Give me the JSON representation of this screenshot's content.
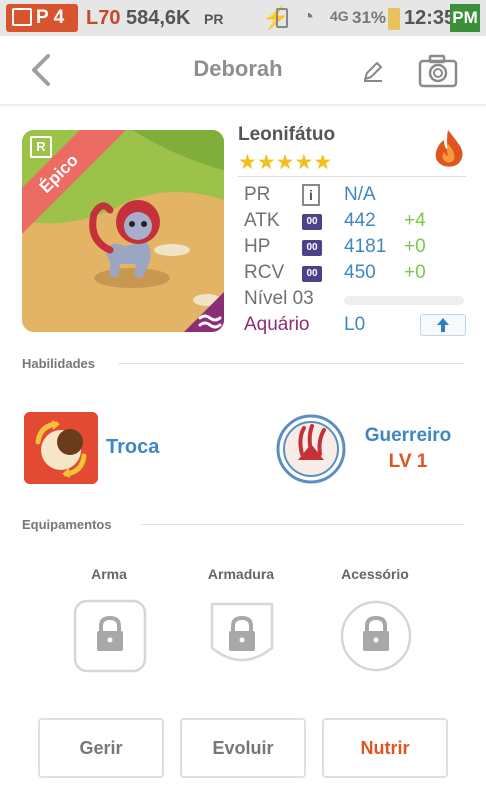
{
  "status_bar": {
    "player_level_prefix": "P 4",
    "level": "L70",
    "score": "584,6K",
    "score_suffix": "PR",
    "signal": "4G",
    "battery": "31%",
    "time": "12:35",
    "ampm": "PM"
  },
  "header": {
    "title": "Deborah",
    "icons": [
      "back-icon",
      "pencil-icon",
      "camera-icon"
    ]
  },
  "creature": {
    "name": "Leonifátuo",
    "rarity_label": "Épico",
    "rarity_letter": "R",
    "stars": 5,
    "element": "fire",
    "stats": [
      {
        "name": "PR",
        "value": "N/A",
        "bonus": ""
      },
      {
        "name": "ATK",
        "badge": "00",
        "value": "442",
        "bonus": "+4"
      },
      {
        "name": "HP",
        "badge": "00",
        "value": "4181",
        "bonus": "+0"
      },
      {
        "name": "RCV",
        "badge": "00",
        "value": "450",
        "bonus": "+0"
      }
    ],
    "nivel_label": "Nível 03",
    "aquario_label": "Aquário",
    "aquario_value": "L0",
    "level_progress": 0
  },
  "abilities": {
    "section_title": "Habilidades",
    "ability_name": "Troca",
    "class_name": "Guerreiro",
    "class_level": "LV 1"
  },
  "equipment": {
    "section_title": "Equipamentos",
    "slots": [
      {
        "label": "Arma"
      },
      {
        "label": "Armadura"
      },
      {
        "label": "Acessório"
      }
    ]
  },
  "actions": {
    "manage": "Gerir",
    "evolve": "Evoluir",
    "feed": "Nutrir"
  },
  "colors": {
    "accent_blue": "#3e87c4",
    "bonus_green": "#79c94a",
    "orange": "#e0541f",
    "epic_ribbon": "#ec6c64",
    "status_red": "#d9532e"
  }
}
